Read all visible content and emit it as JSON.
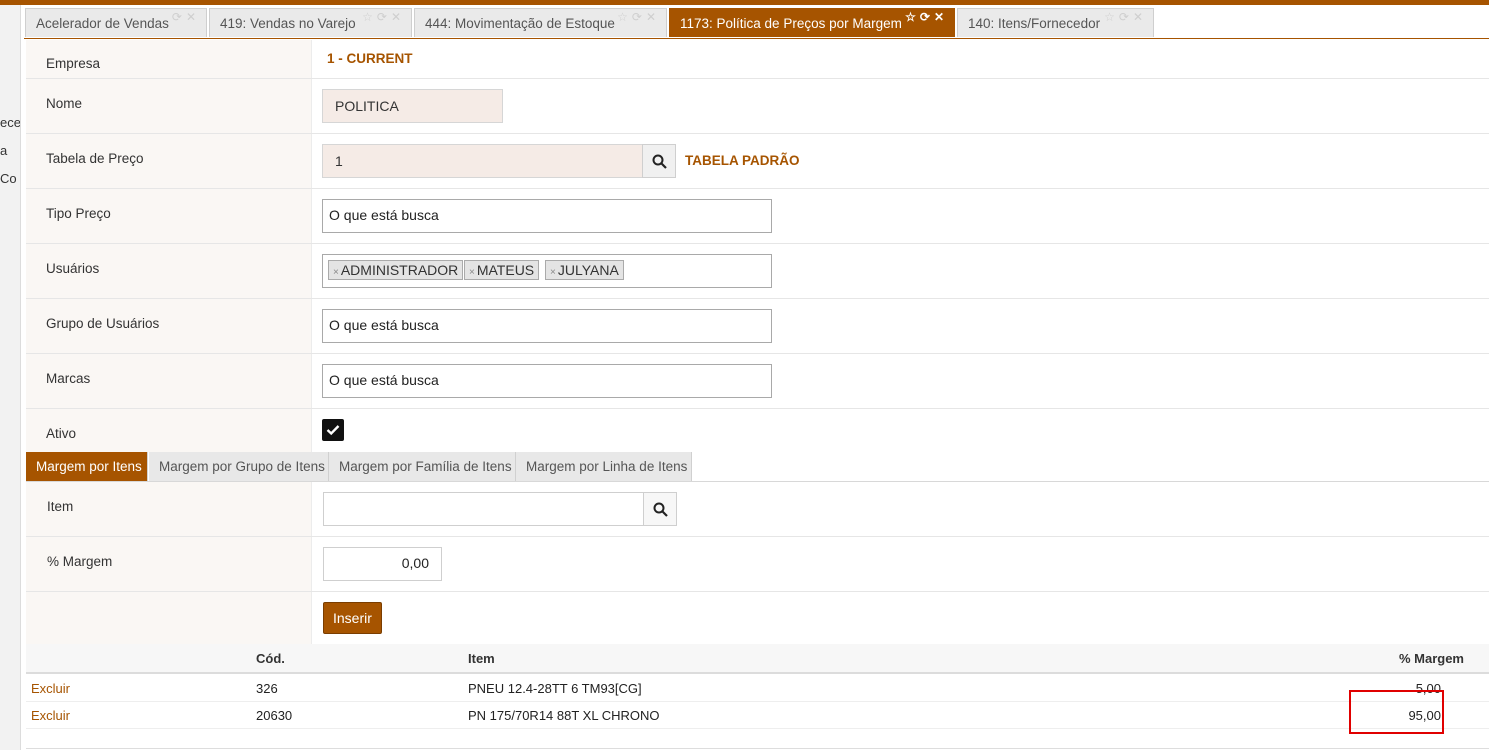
{
  "left_strip": {
    "fragments": [
      "ecel",
      "a",
      "Co"
    ]
  },
  "tabs": [
    {
      "label": "Acelerador de Vendas",
      "active": false
    },
    {
      "label": "419: Vendas no Varejo",
      "active": false
    },
    {
      "label": "444: Movimentação de Estoque",
      "active": false
    },
    {
      "label": "1173: Política de Preços por Margem",
      "active": true
    },
    {
      "label": "140: Itens/Fornecedor",
      "active": false
    }
  ],
  "form": {
    "empresa": {
      "label": "Empresa",
      "value": "1 - CURRENT"
    },
    "nome": {
      "label": "Nome",
      "value": "POLITICA"
    },
    "tabela_preco": {
      "label": "Tabela de Preço",
      "value": "1",
      "description": "TABELA PADRÃO"
    },
    "tipo_preco": {
      "label": "Tipo Preço",
      "placeholder": "O que está busca"
    },
    "usuarios": {
      "label": "Usuários",
      "chips": [
        "ADMINISTRADOR",
        "MATEUS",
        "JULYANA"
      ]
    },
    "grupo_usuarios": {
      "label": "Grupo de Usuários",
      "placeholder": "O que está busca"
    },
    "marcas": {
      "label": "Marcas",
      "placeholder": "O que está busca"
    },
    "ativo": {
      "label": "Ativo",
      "checked": true
    }
  },
  "subtabs": [
    {
      "label": "Margem por Itens",
      "active": true
    },
    {
      "label": "Margem por Grupo de Itens",
      "active": false
    },
    {
      "label": "Margem por Família de Itens",
      "active": false
    },
    {
      "label": "Margem por Linha de Itens",
      "active": false
    }
  ],
  "margin_form": {
    "item": {
      "label": "Item",
      "value": ""
    },
    "margem": {
      "label": "% Margem",
      "value": "0,00"
    },
    "insert_label": "Inserir"
  },
  "table": {
    "columns": [
      "",
      "Cód.",
      "Item",
      "% Margem"
    ],
    "rows": [
      {
        "action": "Excluir",
        "code": "326",
        "item": "PNEU 12.4-28TT 6 TM93[CG]",
        "margin": "5,00"
      },
      {
        "action": "Excluir",
        "code": "20630",
        "item": "PN 175/70R14 88T XL CHRONO",
        "margin": "95,00"
      }
    ]
  },
  "colors": {
    "accent": "#a65400",
    "highlight": "#e00000"
  }
}
